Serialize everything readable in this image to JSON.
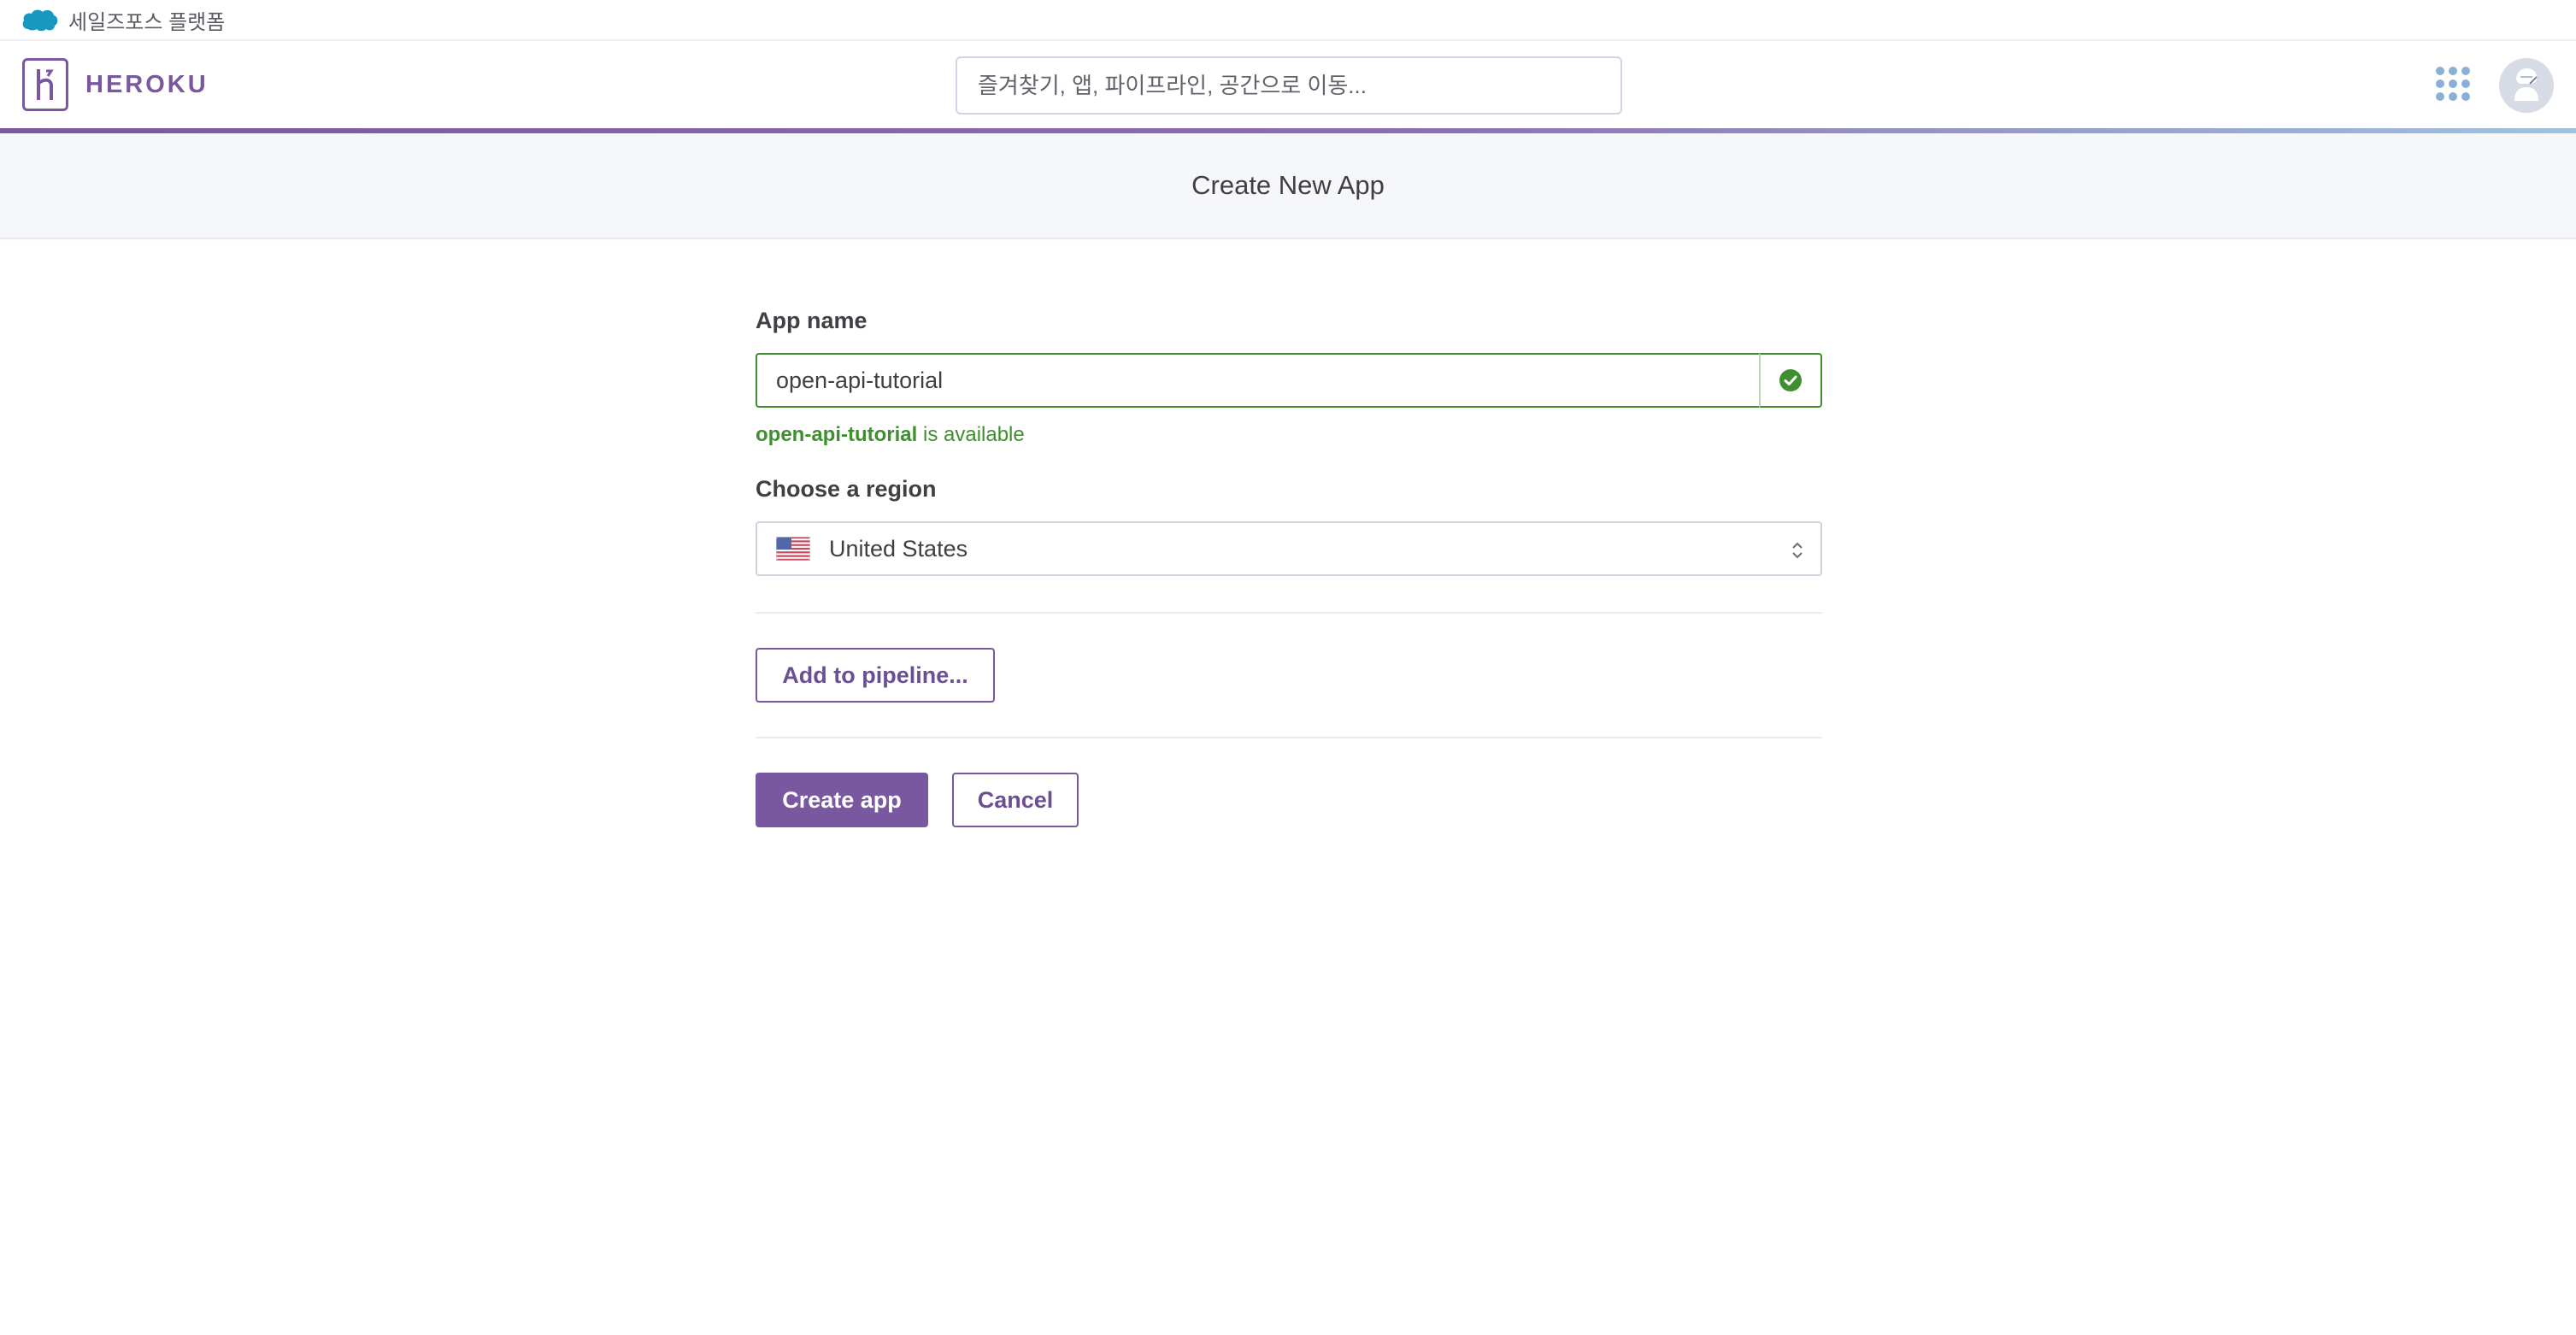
{
  "salesforce_bar": {
    "label": "세일즈포스 플랫폼"
  },
  "header": {
    "wordmark": "HEROKU",
    "search_placeholder": "즐겨찾기, 앱, 파이프라인, 공간으로 이동...",
    "accent_color": "#79589f"
  },
  "page": {
    "title": "Create New App"
  },
  "form": {
    "app_name_label": "App name",
    "app_name_value": "open-api-tutorial",
    "availability": {
      "name": "open-api-tutorial",
      "suffix": " is available"
    },
    "region_label": "Choose a region",
    "region_value": "United States",
    "pipeline_button": "Add to pipeline...",
    "create_button": "Create app",
    "cancel_button": "Cancel"
  },
  "icons": [
    "salesforce-cloud-icon",
    "heroku-logo-icon",
    "apps-grid-icon",
    "avatar-icon",
    "check-circle-icon",
    "us-flag-icon",
    "select-chevron-icon"
  ],
  "colors": {
    "success": "#3f8f2f",
    "brand": "#79589f",
    "apps_dots": "#8ab0d6"
  }
}
